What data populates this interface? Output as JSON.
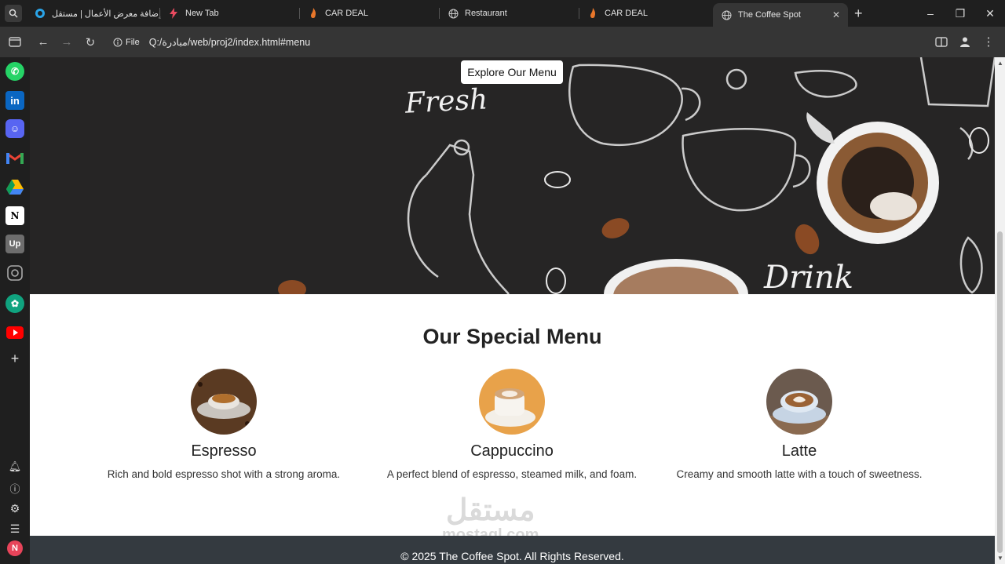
{
  "browser": {
    "tabs": [
      {
        "title": "إضافة معرض الأعمال | مستقل",
        "active": false
      },
      {
        "title": "New Tab",
        "active": false
      },
      {
        "title": "CAR DEAL",
        "active": false
      },
      {
        "title": "Restaurant",
        "active": false
      },
      {
        "title": "CAR DEAL",
        "active": false
      },
      {
        "title": "The Coffee Spot",
        "active": true
      }
    ],
    "url_scheme_label": "File",
    "url": "Q:/مبادرة/web/proj2/index.html#menu"
  },
  "sidebar": {
    "apps": [
      "whatsapp-icon",
      "linkedin-icon",
      "discord-icon",
      "gmail-icon",
      "google-drive-icon",
      "notion-icon",
      "upwork-icon",
      "instagram-icon",
      "chatgpt-icon",
      "youtube-icon"
    ],
    "profile_initial": "N"
  },
  "hero": {
    "button_label": "Explore Our Menu",
    "art_text_1": "Fresh",
    "art_text_2": "Drink"
  },
  "menu": {
    "title": "Our Special Menu",
    "items": [
      {
        "name": "Espresso",
        "description": "Rich and bold espresso shot with a strong aroma."
      },
      {
        "name": "Cappuccino",
        "description": "A perfect blend of espresso, steamed milk, and foam."
      },
      {
        "name": "Latte",
        "description": "Creamy and smooth latte with a touch of sweetness."
      }
    ]
  },
  "watermark": {
    "arabic": "مستقل",
    "latin": "mostaql.com"
  },
  "footer": {
    "text": "© 2025 The Coffee Spot. All Rights Reserved."
  },
  "colors": {
    "hero_bg": "#262525",
    "footer_bg": "#343a40",
    "browser_chrome": "#1f1f1f",
    "toolbar": "#353535"
  }
}
